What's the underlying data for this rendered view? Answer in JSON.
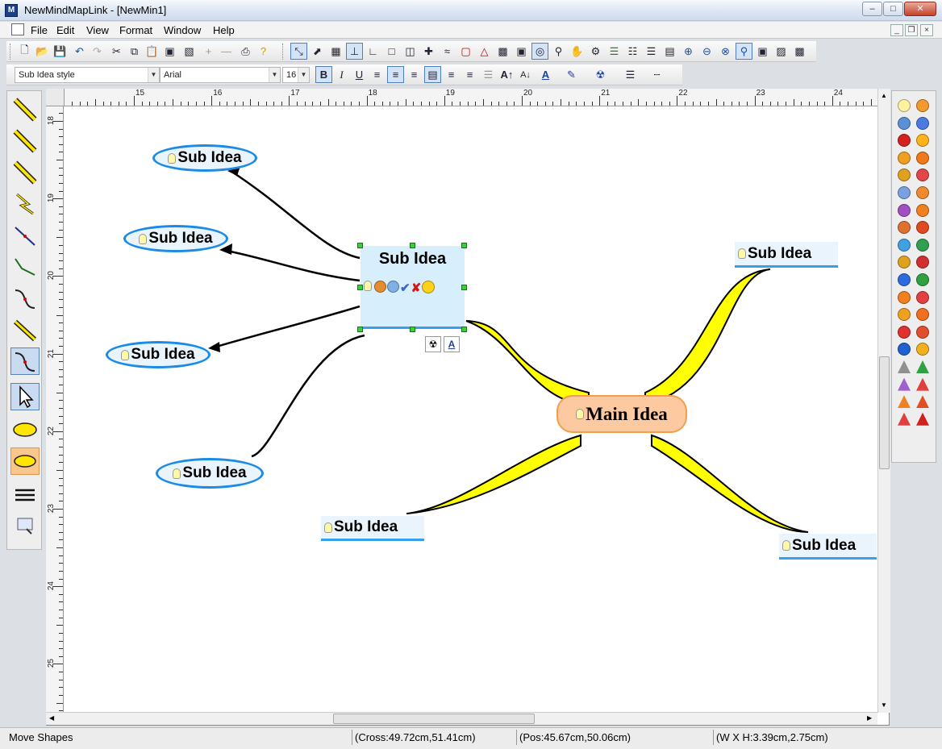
{
  "window": {
    "title": "NewMindMapLink - [NewMin1]"
  },
  "menu": [
    "File",
    "Edit",
    "View",
    "Format",
    "Window",
    "Help"
  ],
  "format_bar": {
    "style": "Sub Idea style",
    "font": "Arial",
    "size": "16",
    "bold": "B"
  },
  "rulers": {
    "horizontal": [
      "15",
      "16",
      "17",
      "18",
      "19",
      "20",
      "21",
      "22",
      "23",
      "24"
    ],
    "vertical": [
      "18",
      "19",
      "20",
      "21",
      "22",
      "23",
      "24",
      "25"
    ]
  },
  "canvas": {
    "main": "Main Idea",
    "selected": "Sub Idea",
    "ellipses": [
      "Sub Idea",
      "Sub Idea",
      "Sub Idea",
      "Sub Idea"
    ],
    "lines": [
      "Sub Idea",
      "Sub Idea",
      "Sub Idea"
    ]
  },
  "status": {
    "mode": "Move Shapes",
    "cross": "(Cross:49.72cm,51.41cm)",
    "pos": "(Pos:45.67cm,50.06cm)",
    "size": "(W X H:3.39cm,2.75cm)"
  },
  "colors": {
    "accent": "#1b8be6",
    "main_fill": "#fcc9a0",
    "branch": "#ffff00",
    "selection": "#3bd03b"
  }
}
